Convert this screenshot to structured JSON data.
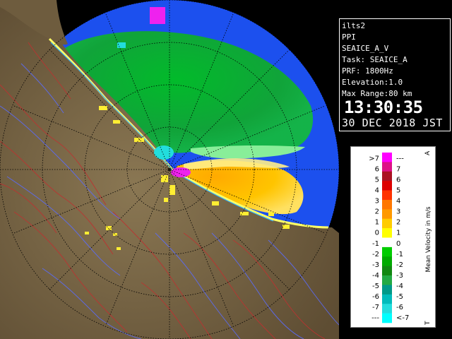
{
  "info": {
    "station": "ilts2",
    "product": "PPI",
    "scan": "SEAICE_A_V",
    "task": "Task: SEAICE_A",
    "prf": "PRF: 1800Hz",
    "elevation": "Elevation:1.0",
    "max_range": "Max Range:80 km",
    "time": "13:30:35",
    "date": "30 DEC 2018 JST"
  },
  "legend": {
    "title": "Mean Velocity in m/s",
    "top_marker": "A",
    "bottom_marker": "T",
    "colors": [
      "#ff00ff",
      "#dd1188",
      "#aa1122",
      "#dd0000",
      "#ff3300",
      "#ff7700",
      "#ff9900",
      "#ffcc00",
      "#ffff00",
      "#ffffff",
      "#00cc00",
      "#00aa00",
      "#118811",
      "#22aa44",
      "#009988",
      "#00bbbb",
      "#22dddd",
      "#00ffff"
    ],
    "labels_left": [
      ">7",
      "6",
      "5",
      "4",
      "3",
      "2",
      "1",
      "0",
      "-1",
      "-2",
      "-3",
      "-4",
      "-5",
      "-6",
      "-7",
      "---"
    ],
    "labels_right": [
      "---",
      "7",
      "6",
      "5",
      "4",
      "3",
      "2",
      "1",
      "0",
      "-1",
      "-2",
      "-3",
      "-4",
      "-5",
      "-6",
      "<-7"
    ]
  },
  "radar": {
    "sea_color": "#1c50ee",
    "range_ring_color": "#000000",
    "land_color": "#7d6a4a",
    "coast_color": "#ffff66"
  }
}
